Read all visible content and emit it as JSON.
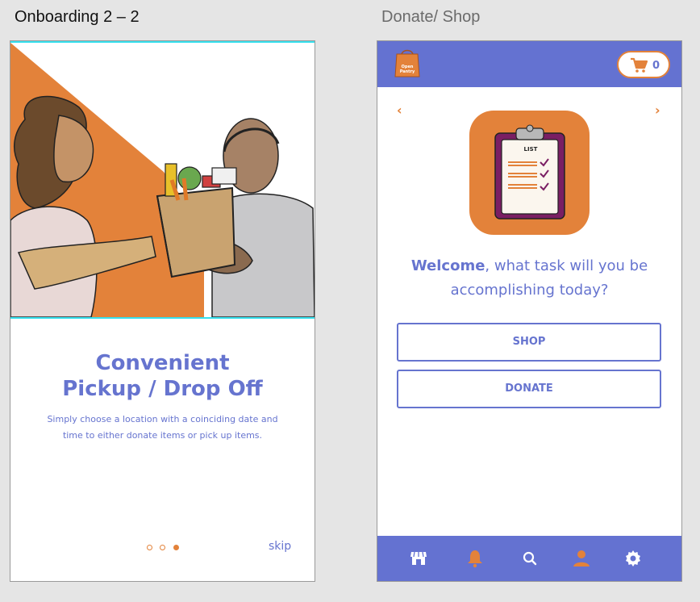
{
  "frames": {
    "left_title": "Onboarding 2 – 2",
    "right_title": "Donate/ Shop"
  },
  "onboarding": {
    "title_line1": "Convenient",
    "title_line2": "Pickup / Drop Off",
    "description_line1": "Simply choose a location with a coinciding date and",
    "description_line2": "time to either donate items or pick up items.",
    "pagination": {
      "total": 3,
      "active": 3
    },
    "skip_label": "skip"
  },
  "shop_screen": {
    "logo_text_1": "Open",
    "logo_text_2": "Pantry",
    "cart_count": "0",
    "hero_icon_text": "LIST",
    "welcome_bold": "Welcome",
    "welcome_rest": ", what task will you be",
    "welcome_line2": "accomplishing today?",
    "shop_button_label": "SHOP",
    "donate_button_label": "DONATE",
    "nav_items": [
      {
        "icon": "store-icon",
        "active": false
      },
      {
        "icon": "bell-icon",
        "active": true
      },
      {
        "icon": "search-icon",
        "active": false
      },
      {
        "icon": "profile-icon",
        "active": true
      },
      {
        "icon": "settings-icon",
        "active": false
      }
    ]
  },
  "colors": {
    "brand_purple": "#6674cf",
    "brand_orange": "#e3823a",
    "topbar": "#6472d1"
  }
}
